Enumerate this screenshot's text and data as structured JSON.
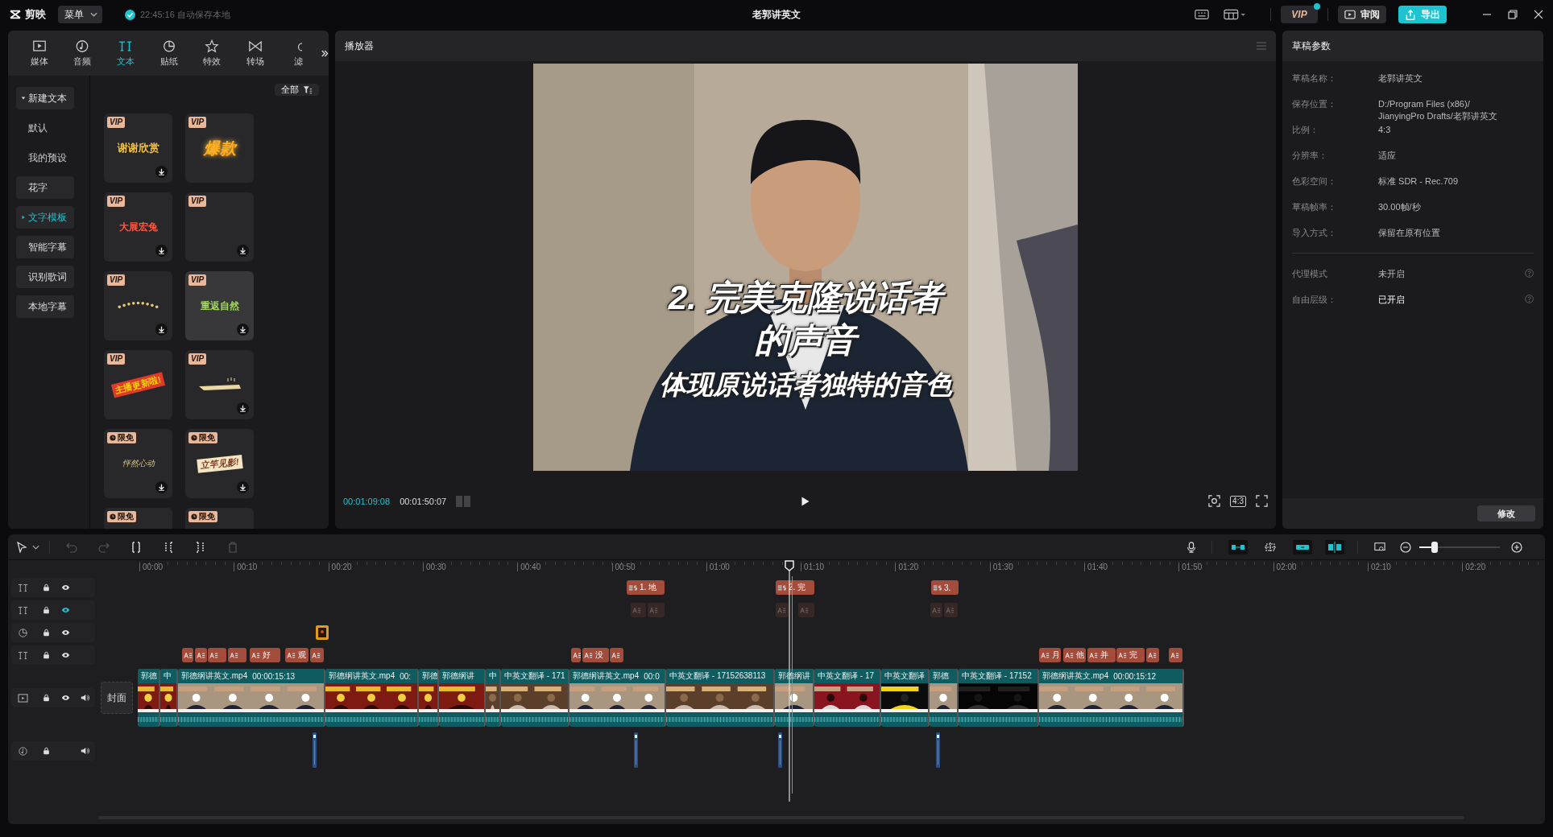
{
  "topbar": {
    "logo": "剪映",
    "menu": "菜单",
    "autosave": "22:45:16 自动保存本地",
    "title": "老郭讲英文",
    "vip": "VIP",
    "review": "审阅",
    "export": "导出"
  },
  "left_panel": {
    "tabs": [
      {
        "label": "媒体",
        "kind": "media",
        "selected": false
      },
      {
        "label": "音频",
        "kind": "audio",
        "selected": false
      },
      {
        "label": "文本",
        "kind": "text",
        "selected": true
      },
      {
        "label": "贴纸",
        "kind": "sticker",
        "selected": false
      },
      {
        "label": "特效",
        "kind": "effect",
        "selected": false
      },
      {
        "label": "转场",
        "kind": "transition",
        "selected": false
      },
      {
        "label": "滤",
        "kind": "filter",
        "selected": false
      }
    ],
    "nav": [
      {
        "label": "新建文本",
        "kind": "group",
        "expanded": true,
        "selected": false,
        "children": [
          {
            "label": "默认",
            "selected": false
          },
          {
            "label": "我的预设",
            "selected": false
          }
        ]
      },
      {
        "label": "花字",
        "kind": "item",
        "selected": false
      },
      {
        "label": "文字模板",
        "kind": "group",
        "expanded": false,
        "selected": true
      },
      {
        "label": "智能字幕",
        "kind": "item",
        "selected": false
      },
      {
        "label": "识别歌词",
        "kind": "item",
        "selected": false
      },
      {
        "label": "本地字幕",
        "kind": "item",
        "selected": false
      }
    ],
    "filter": "全部",
    "templates": [
      {
        "badge": "VIP",
        "kind": "vip",
        "preview": "谢谢欣赏",
        "download": true,
        "hovered": false
      },
      {
        "badge": "VIP",
        "kind": "vip",
        "preview": "爆款",
        "download": false,
        "hovered": false
      },
      {
        "badge": "VIP",
        "kind": "vip",
        "preview": "大展宏兔",
        "download": true,
        "hovered": false
      },
      {
        "badge": "VIP",
        "kind": "vip",
        "download": true,
        "hovered": false
      },
      {
        "badge": "VIP",
        "kind": "vip",
        "download": true,
        "hovered": false
      },
      {
        "badge": "VIP",
        "kind": "vip",
        "preview": "重返自然",
        "download": true,
        "hovered": true
      },
      {
        "badge": "VIP",
        "kind": "vip",
        "preview": "主播更新啦!",
        "download": false,
        "hovered": false
      },
      {
        "badge": "VIP",
        "kind": "vip",
        "download": true,
        "hovered": false
      },
      {
        "badge": "限免",
        "kind": "limited",
        "preview": "怦然心动",
        "download": true,
        "hovered": false
      },
      {
        "badge": "限免",
        "kind": "limited",
        "preview": "立竿见影!",
        "download": true,
        "hovered": false
      },
      {
        "badge": "限免",
        "kind": "limited",
        "download": false,
        "hovered": false
      },
      {
        "badge": "限免",
        "kind": "limited",
        "download": false,
        "hovered": false
      }
    ]
  },
  "player": {
    "title": "播放器",
    "captions": [
      {
        "text": "2. 完美克隆说话者",
        "kind": "title"
      },
      {
        "text": "的声音",
        "kind": "title"
      },
      {
        "text": "体现原说话者独特的音色",
        "kind": "subtitle"
      }
    ],
    "current_time": "00:01:09:08",
    "duration": "00:01:50:07",
    "ratio": "4:3"
  },
  "draft": {
    "title": "草稿参数",
    "fields": [
      {
        "label": "草稿名称：",
        "value": "老郭讲英文"
      },
      {
        "label": "保存位置：",
        "value": "D:/Program Files (x86)/ JianyingPro Drafts/老郭讲英文"
      },
      {
        "label": "比例：",
        "value": "4:3"
      },
      {
        "label": "分辨率：",
        "value": "适应"
      },
      {
        "label": "色彩空间：",
        "value": "标准 SDR - Rec.709"
      },
      {
        "label": "草稿帧率：",
        "value": "30.00帧/秒"
      },
      {
        "label": "导入方式：",
        "value": "保留在原有位置"
      }
    ],
    "toggles": [
      {
        "label": "代理模式",
        "value": "未开启",
        "on": false
      },
      {
        "label": "自由层级：",
        "value": "已开启",
        "on": true
      }
    ],
    "button": "修改"
  },
  "timeline": {
    "cover": "封面",
    "zoom": {
      "level": 0.19
    },
    "ruler": [
      "00:00",
      "00:10",
      "00:20",
      "00:30",
      "00:40",
      "00:50",
      "01:00",
      "01:10",
      "01:20",
      "01:30",
      "01:40",
      "01:50",
      "02:00",
      "02:10",
      "02:20"
    ],
    "tracks": [
      {
        "kind": "text",
        "eye_active": false,
        "clips": [
          {
            "kind": "subtitle",
            "label": "1. 地",
            "faded": false
          },
          {
            "kind": "subtitle",
            "label": "2. 完",
            "faded": false
          },
          {
            "kind": "subtitle",
            "label": "3.",
            "faded": false
          }
        ]
      },
      {
        "kind": "text",
        "eye_active": true,
        "clips": [
          {
            "kind": "text",
            "faded": true
          },
          {
            "kind": "text",
            "faded": true
          },
          {
            "kind": "text",
            "faded": true
          },
          {
            "kind": "text",
            "faded": true
          },
          {
            "kind": "text",
            "faded": true
          },
          {
            "kind": "text",
            "faded": true
          }
        ]
      },
      {
        "kind": "sticker",
        "eye_active": false,
        "clips": [
          {
            "kind": "sticker",
            "faded": false
          }
        ]
      },
      {
        "kind": "text",
        "eye_active": false,
        "clips": [
          {
            "kind": "text",
            "faded": false
          },
          {
            "kind": "text",
            "faded": false
          },
          {
            "kind": "text",
            "faded": false
          },
          {
            "kind": "text",
            "faded": false
          },
          {
            "kind": "text",
            "label": "好",
            "faded": false
          },
          {
            "kind": "text",
            "label": "观",
            "faded": false
          },
          {
            "kind": "text",
            "faded": false
          },
          {
            "kind": "text",
            "faded": false
          },
          {
            "kind": "text",
            "label": "没",
            "faded": false
          },
          {
            "kind": "text",
            "faded": false
          },
          {
            "kind": "text",
            "label": "月",
            "faded": false
          },
          {
            "kind": "text",
            "label": "他",
            "faded": false
          },
          {
            "kind": "text",
            "label": "并",
            "faded": false
          },
          {
            "kind": "text",
            "label": "完",
            "faded": false
          },
          {
            "kind": "text",
            "faded": false
          },
          {
            "kind": "text",
            "faded": false
          }
        ]
      },
      {
        "kind": "video",
        "eye_active": false,
        "clips": [
          {
            "name": "郭德"
          },
          {
            "name": "中"
          },
          {
            "name": "郭德纲讲英文.mp4",
            "duration": "00:00:15:13"
          },
          {
            "name": "郭德纲讲英文.mp4",
            "duration": "00:"
          },
          {
            "name": "郭德"
          },
          {
            "name": "郭德纲讲"
          },
          {
            "name": "中"
          },
          {
            "name": "中英文翻译 - 171"
          },
          {
            "name": "郭德纲讲英文.mp4",
            "duration": "00:0"
          },
          {
            "name": "中英文翻译 - 17152638113"
          },
          {
            "name": "郭德纲讲"
          },
          {
            "name": "中英文翻译 - 17"
          },
          {
            "name": "中英文翻译"
          },
          {
            "name": "郭德"
          },
          {
            "name": "中英文翻译 - 17152"
          },
          {
            "name": "郭德纲讲英文.mp4",
            "duration": "00:00:15:12"
          }
        ]
      },
      {
        "kind": "audio",
        "clips": [
          {
            "kind": "marker"
          },
          {
            "kind": "marker"
          },
          {
            "kind": "marker"
          },
          {
            "kind": "marker"
          }
        ]
      }
    ]
  }
}
